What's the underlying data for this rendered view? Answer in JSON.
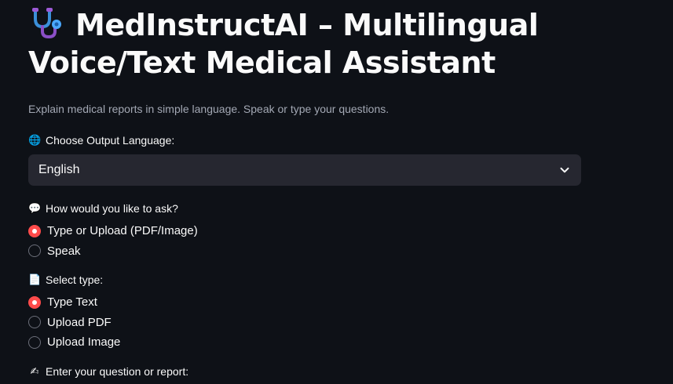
{
  "title": {
    "icon": "stethoscope-icon",
    "line1": "MedInstructAI – Multilingual",
    "line2": "Voice/Text Medical Assistant"
  },
  "subtitle": "Explain medical reports in simple language. Speak or type your questions.",
  "language": {
    "icon": "globe-icon",
    "label": "Choose Output Language:",
    "selected": "English"
  },
  "ask_mode": {
    "icon": "speech-bubble-icon",
    "label": "How would you like to ask?",
    "options": [
      "Type or Upload (PDF/Image)",
      "Speak"
    ],
    "selected_index": 0
  },
  "input_type": {
    "icon": "document-icon",
    "label": "Select type:",
    "options": [
      "Type Text",
      "Upload PDF",
      "Upload Image"
    ],
    "selected_index": 0
  },
  "question": {
    "icon": "writing-hand-icon",
    "label": "Enter your question or report:"
  },
  "colors": {
    "background": "#0e1117",
    "accent": "#ff4b4b",
    "select_bg": "#262730",
    "muted_text": "#a3a8b4"
  }
}
